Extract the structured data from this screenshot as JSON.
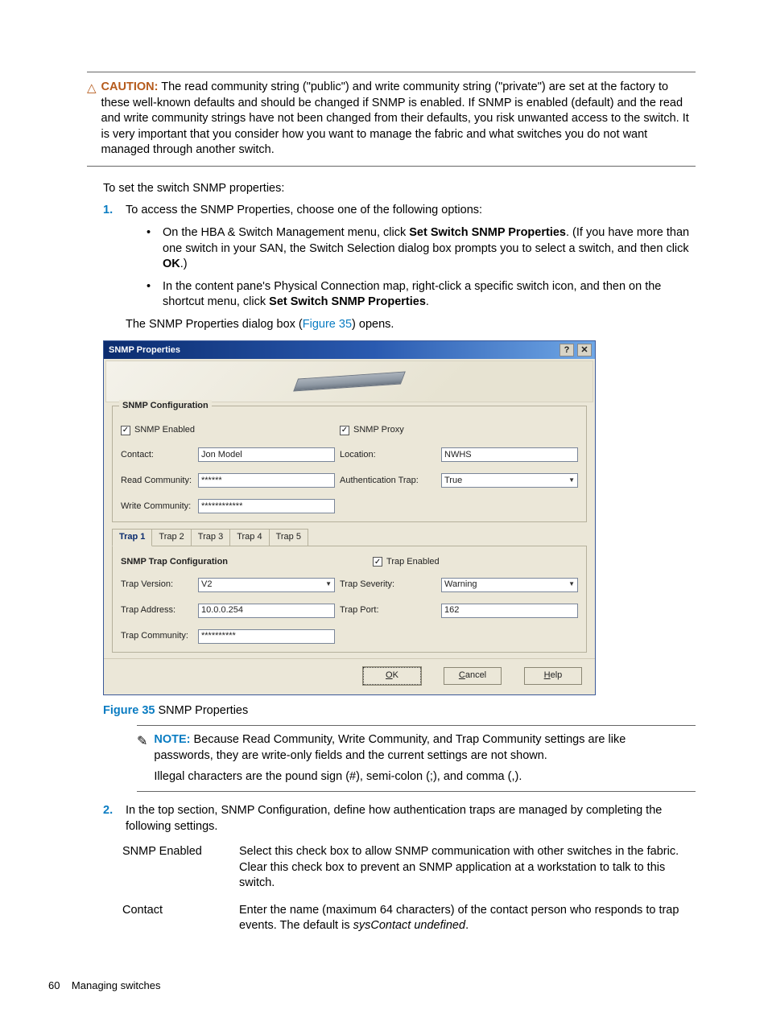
{
  "caution": {
    "label": "CAUTION:",
    "text": "The read community string (\"public\") and write community string (\"private\") are set at the factory to these well-known defaults and should be changed if SNMP is enabled. If SNMP is enabled (default) and the read and write community strings have not been changed from their defaults, you risk unwanted access to the switch. It is very important that you consider how you want to manage the fabric and what switches you do not want managed through another switch."
  },
  "intro": "To set the switch SNMP properties:",
  "step1": {
    "num": "1.",
    "text": "To access the SNMP Properties, choose one of the following options:",
    "b1a": "On the HBA & Switch Management menu, click ",
    "b1b_bold": "Set Switch SNMP Properties",
    "b1c": ". (If you have more than one switch in your SAN, the Switch Selection dialog box prompts you to select a switch, and then click ",
    "b1d_bold": "OK",
    "b1e": ".)",
    "b2a": "In the content pane's Physical Connection map, right-click a specific switch icon, and then on the shortcut menu, click ",
    "b2b_bold": "Set Switch SNMP Properties",
    "b2c": ".",
    "closing_a": "The SNMP Properties dialog box (",
    "closing_link": "Figure 35",
    "closing_b": ") opens."
  },
  "dialog": {
    "title": "SNMP Properties",
    "snmp_config_title": "SNMP Configuration",
    "snmp_enabled": "SNMP Enabled",
    "snmp_proxy": "SNMP Proxy",
    "contact_label": "Contact:",
    "contact_value": "Jon Model",
    "location_label": "Location:",
    "location_value": "NWHS",
    "readcomm_label": "Read Community:",
    "readcomm_value": "******",
    "authtrap_label": "Authentication Trap:",
    "authtrap_value": "True",
    "writecomm_label": "Write Community:",
    "writecomm_value": "************",
    "tabs": [
      "Trap 1",
      "Trap 2",
      "Trap 3",
      "Trap 4",
      "Trap 5"
    ],
    "trap_config_title": "SNMP Trap Configuration",
    "trap_enabled": "Trap Enabled",
    "trapver_label": "Trap Version:",
    "trapver_value": "V2",
    "trapsev_label": "Trap Severity:",
    "trapsev_value": "Warning",
    "trapaddr_label": "Trap Address:",
    "trapaddr_value": "10.0.0.254",
    "trapport_label": "Trap Port:",
    "trapport_value": "162",
    "trapcomm_label": "Trap Community:",
    "trapcomm_value": "**********",
    "ok": "OK",
    "cancel": "Cancel",
    "help": "Help"
  },
  "figcap": {
    "label": "Figure 35",
    "text": " SNMP Properties"
  },
  "note": {
    "label": "NOTE:",
    "line1": "Because Read Community, Write Community, and Trap Community settings are like passwords, they are write-only fields and the current settings are not shown.",
    "line2": "Illegal characters are the pound sign (#), semi-colon (;), and comma (,)."
  },
  "step2": {
    "num": "2.",
    "text": "In the top section, SNMP Configuration, define how authentication traps are managed by completing the following settings."
  },
  "defs": {
    "snmp_enabled_term": "SNMP Enabled",
    "snmp_enabled_desc": "Select this check box to allow SNMP communication with other switches in the fabric. Clear this check box to prevent an SNMP application at a workstation to talk to this switch.",
    "contact_term": "Contact",
    "contact_desc_a": "Enter the name (maximum 64 characters) of the contact person who responds to trap events. The default is ",
    "contact_desc_italic": "sysContact undefined",
    "contact_desc_b": "."
  },
  "footer": {
    "page": "60",
    "section": "Managing switches"
  }
}
